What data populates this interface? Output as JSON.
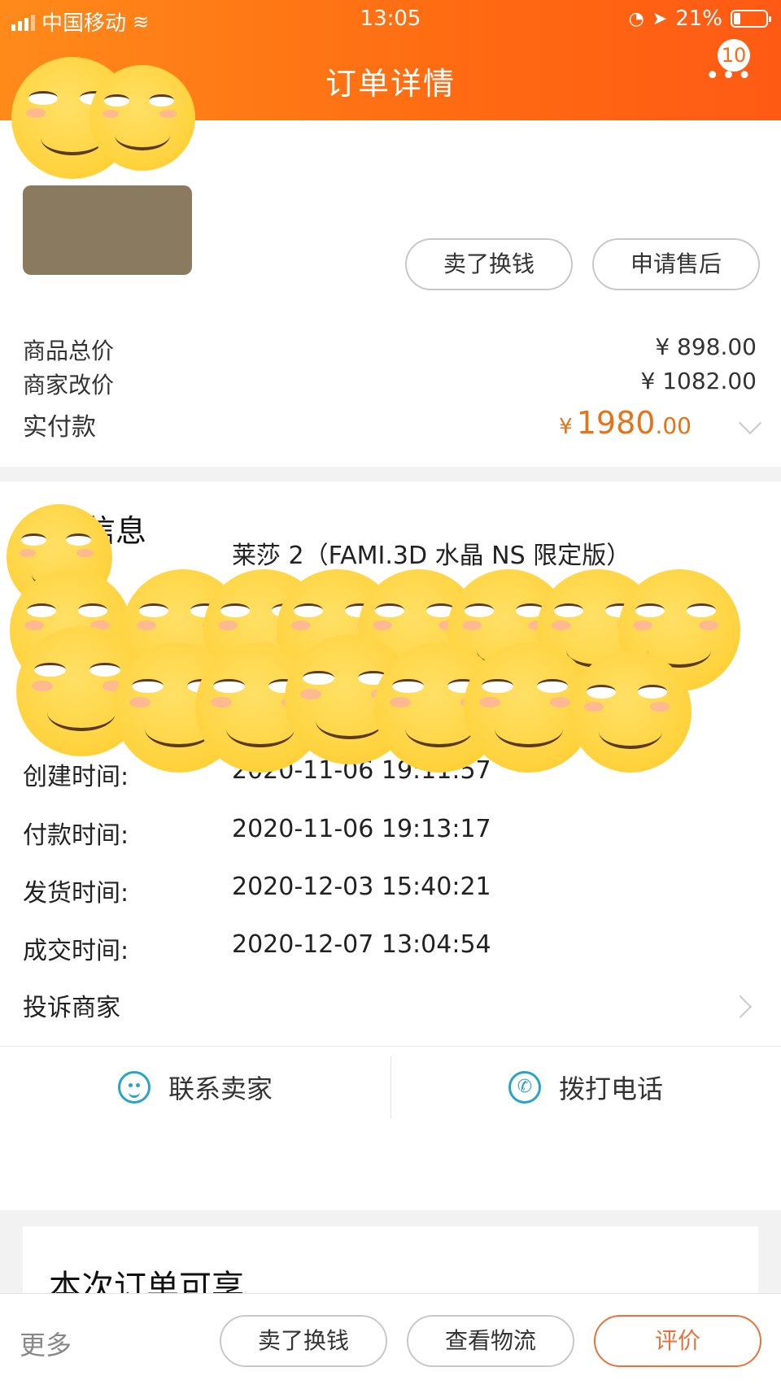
{
  "status_bar": {
    "carrier": "中国移动",
    "time": "13:05",
    "battery": "21%",
    "battery_level": 0.21
  },
  "header": {
    "title": "订单详情",
    "badge_count": "10",
    "back_icon": "chevron-left-icon",
    "more_icon": "more-dots-icon"
  },
  "top_actions": {
    "sell_label": "卖了换钱",
    "aftersale_label": "申请售后"
  },
  "price_summary": {
    "goods_total_label": "商品总价",
    "goods_total_value": "¥ 898.00",
    "merchant_adjust_label": "商家改价",
    "merchant_adjust_value": "¥ 1082.00",
    "paid_label": "实付款",
    "paid_currency": "¥",
    "paid_int": "1980",
    "paid_dec": ".00"
  },
  "order_info": {
    "title": "订单信息",
    "product_value": "莱莎 2（FAMI.3D 水晶 NS 限定版）",
    "rows": [
      {
        "label": "创建时间:",
        "value": "2020-11-06 19:11:57"
      },
      {
        "label": "付款时间:",
        "value": "2020-11-06 19:13:17"
      },
      {
        "label": "发货时间:",
        "value": "2020-12-03 15:40:21"
      },
      {
        "label": "成交时间:",
        "value": "2020-12-07 13:04:54"
      }
    ],
    "complaint_label": "投诉商家"
  },
  "contact": {
    "seller_label": "联系卖家",
    "phone_label": "拨打电话"
  },
  "perks": {
    "title": "本次订单可享"
  },
  "bottom_bar": {
    "more_label": "更多",
    "sell_label": "卖了换钱",
    "logistics_label": "查看物流",
    "review_label": "评价"
  },
  "colors": {
    "header_orange": "#ff6a12",
    "price_orange": "#e5731a",
    "icon_blue": "#2aa3c9"
  }
}
